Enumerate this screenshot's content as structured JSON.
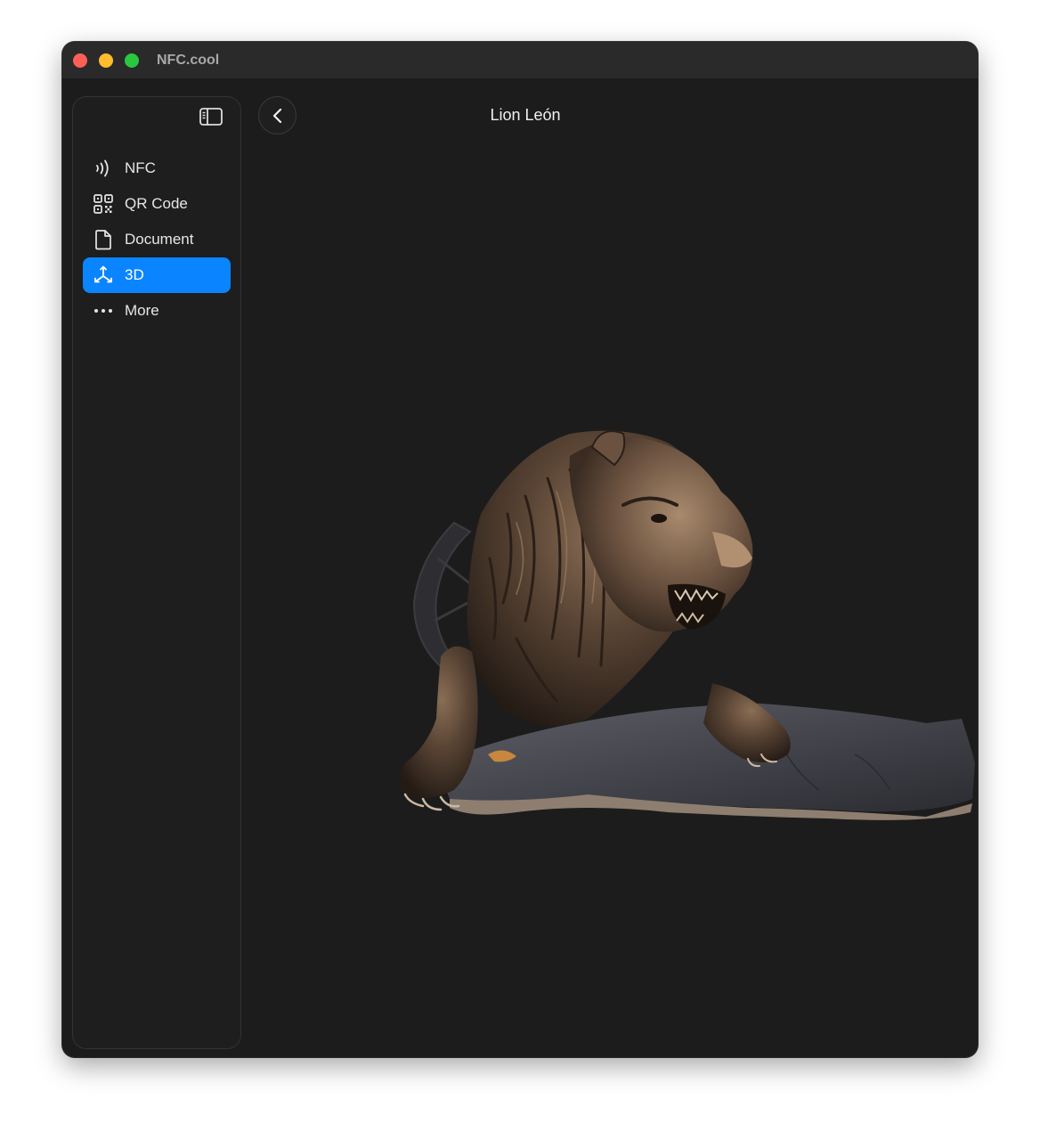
{
  "window": {
    "title": "NFC.cool"
  },
  "sidebar": {
    "toggle_icon": "sidebar-left-icon",
    "items": [
      {
        "label": "NFC",
        "icon": "nfc-waves-icon",
        "active": false
      },
      {
        "label": "QR Code",
        "icon": "qrcode-icon",
        "active": false
      },
      {
        "label": "Document",
        "icon": "document-icon",
        "active": false
      },
      {
        "label": "3D",
        "icon": "3d-axes-icon",
        "active": true
      },
      {
        "label": "More",
        "icon": "ellipsis-icon",
        "active": false
      }
    ]
  },
  "header": {
    "back_icon": "chevron-left-icon",
    "title": "Lion León"
  },
  "viewer": {
    "model": "bronze lion statue on stone slab"
  },
  "colors": {
    "accent": "#0a84ff",
    "window_bg": "#1c1c1c",
    "titlebar_bg": "#2a2a2a",
    "close": "#ff5f57",
    "minimize": "#febc2e",
    "zoom": "#28c840"
  }
}
